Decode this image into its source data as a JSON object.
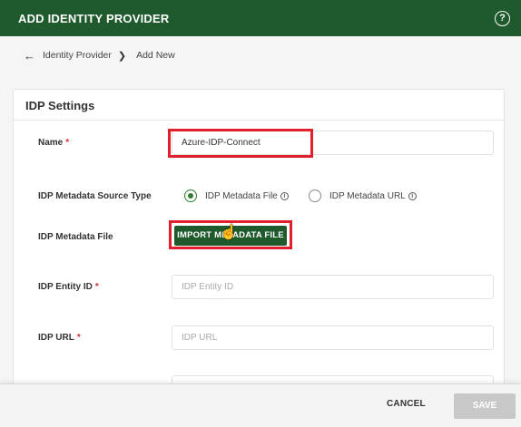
{
  "header": {
    "title": "ADD IDENTITY PROVIDER",
    "help_icon": "question-circle-icon",
    "help_glyph": "?"
  },
  "breadcrumb": {
    "back_icon": "arrow-left-icon",
    "parent": "Identity Provider",
    "current": "Add New"
  },
  "card": {
    "title": "IDP Settings"
  },
  "form": {
    "name": {
      "label": "Name",
      "required": "*",
      "value": "Azure-IDP-Connect"
    },
    "source_type": {
      "label": "IDP Metadata Source Type",
      "options": [
        {
          "label": "IDP Metadata File",
          "selected": true
        },
        {
          "label": "IDP Metadata URL",
          "selected": false
        }
      ]
    },
    "metadata_file": {
      "label": "IDP Metadata File",
      "button": "IMPORT METADATA FILE"
    },
    "entity_id": {
      "label": "IDP Entity ID",
      "required": "*",
      "placeholder": "IDP Entity ID",
      "value": ""
    },
    "idp_url": {
      "label": "IDP URL",
      "required": "*",
      "placeholder": "IDP URL",
      "value": ""
    }
  },
  "footer": {
    "cancel": "CANCEL",
    "save": "SAVE"
  },
  "colors": {
    "brand": "#1e5a2c",
    "highlight": "#e0202a",
    "required": "#d32f2f",
    "save_disabled": "#c8c8c8"
  }
}
